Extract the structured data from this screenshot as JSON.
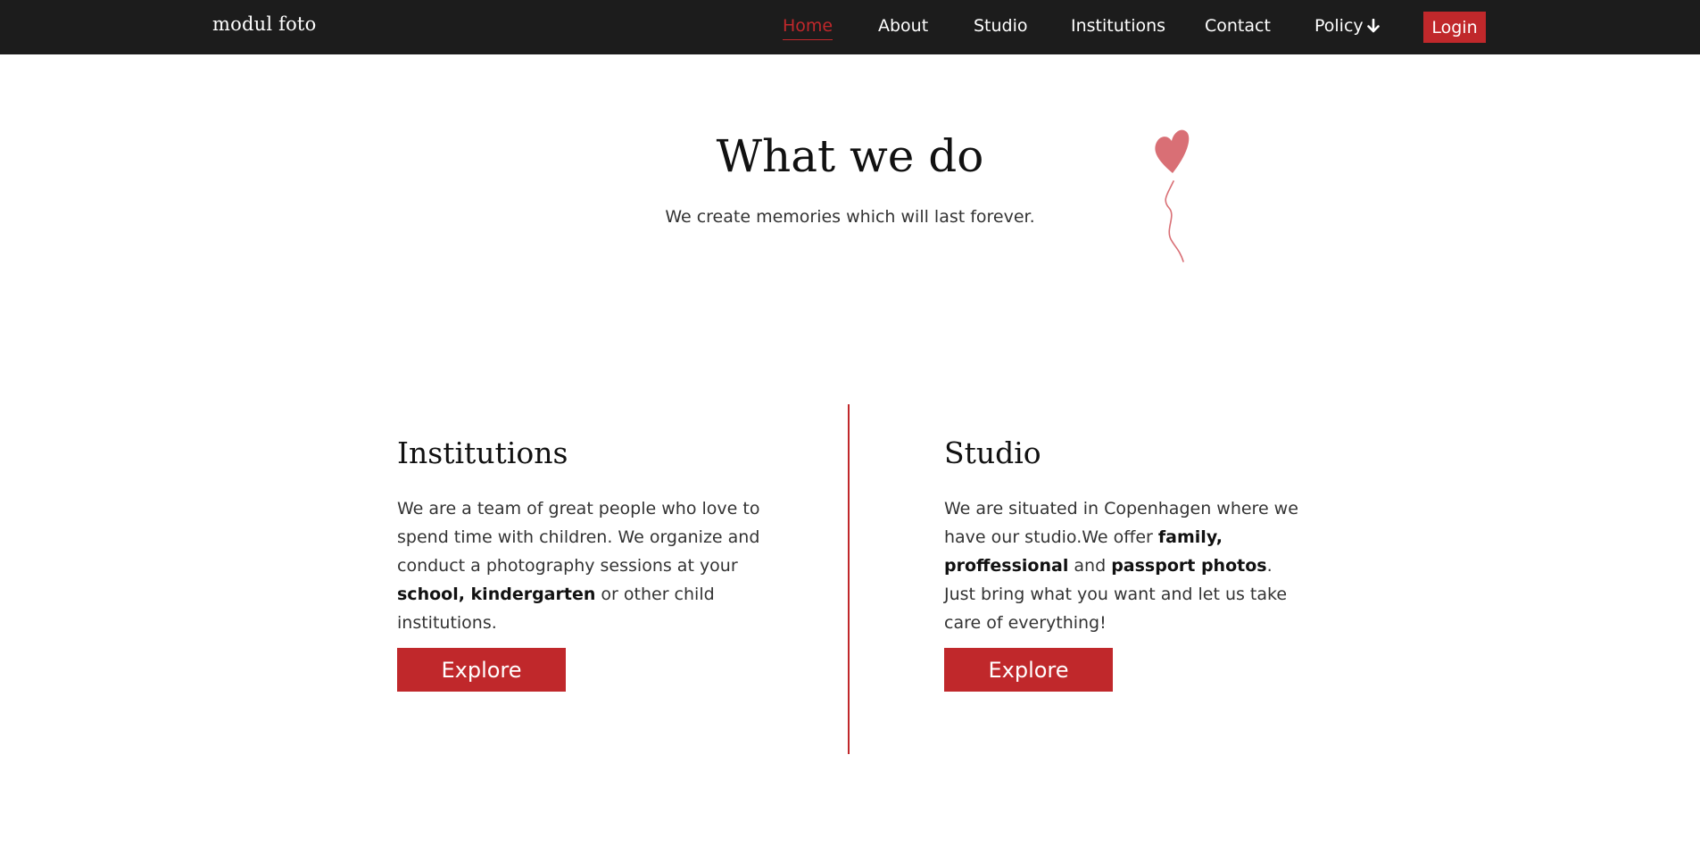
{
  "nav": {
    "brand": "modul foto",
    "items": [
      {
        "label": "Home",
        "active": true
      },
      {
        "label": "About"
      },
      {
        "label": "Studio"
      },
      {
        "label": "Institutions"
      },
      {
        "label": "Contact"
      },
      {
        "label": "Policy",
        "icon": "arrow-down-icon"
      }
    ],
    "login": "Login"
  },
  "hero": {
    "title": "What we do",
    "subtitle": "We create memories which will last forever.",
    "decoration": "heart-balloon-icon"
  },
  "sections": {
    "institutions": {
      "title": "Institutions",
      "text_1": "We are a team of great people who love to spend time with children. We organize and conduct a photography sessions at your ",
      "bold_1": "school, kindergarten",
      "text_2": " or other child institutions.",
      "button": "Explore"
    },
    "studio": {
      "title": "Studio",
      "text_1": "We are situated in Copenhagen where we have our studio.We offer ",
      "bold_1": "family, proffessional",
      "text_2": " and ",
      "bold_2": "passport photos",
      "text_3": ". Just bring what you want and let us take care of everything!",
      "button": "Explore"
    }
  },
  "colors": {
    "accent": "#c0282b",
    "navbar": "#1c1c1c",
    "balloon": "#d96f75"
  }
}
